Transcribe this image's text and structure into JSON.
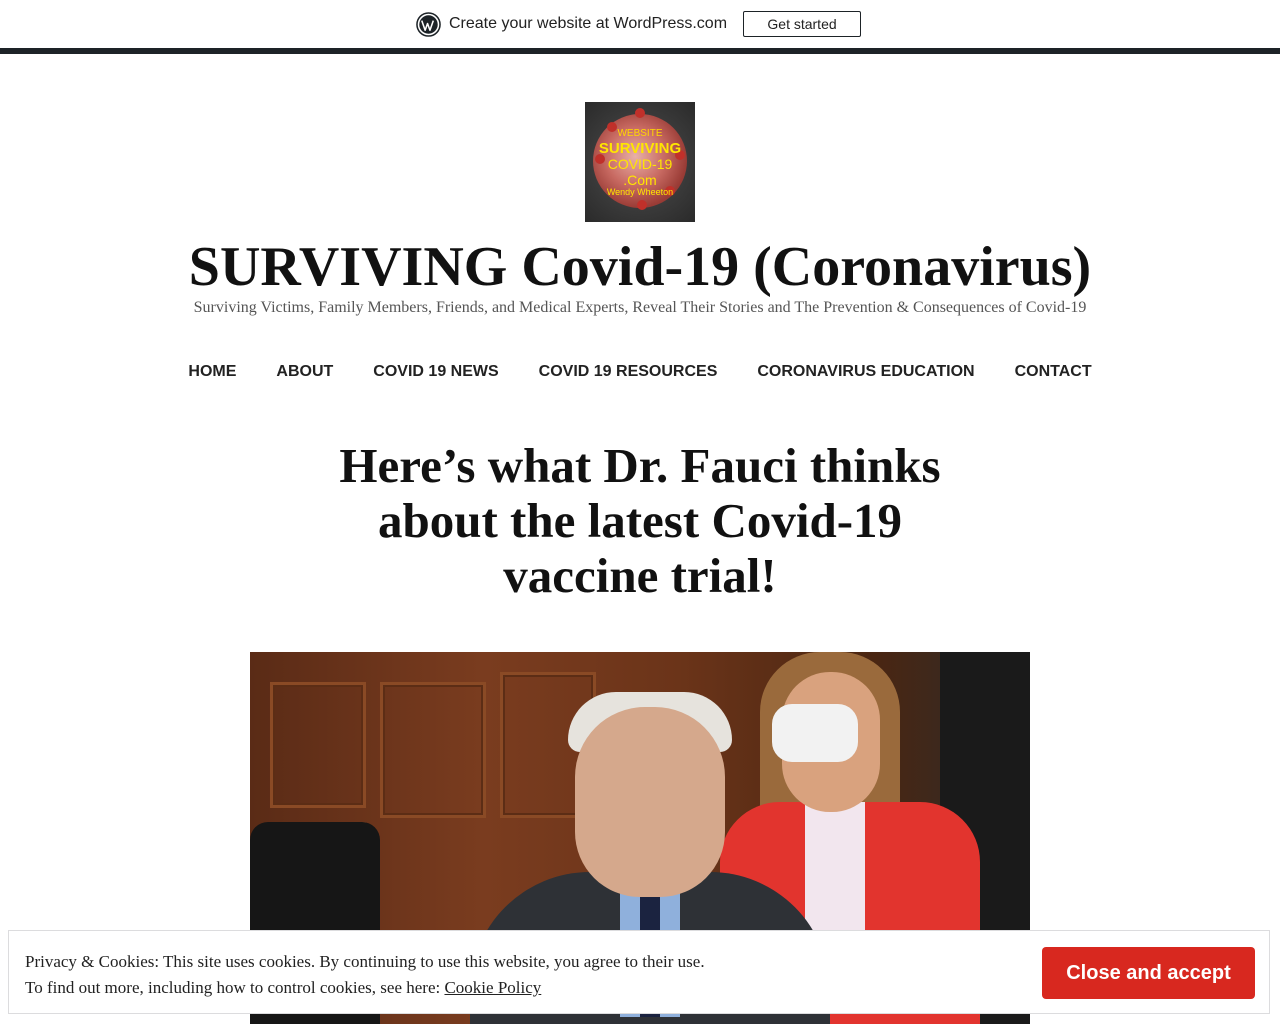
{
  "wpbar": {
    "text": "Create your website at WordPress.com",
    "button_label": "Get started"
  },
  "site": {
    "logo_text": {
      "line1": "WEBSITE",
      "line2": "SURVIVING",
      "line3": "COVID-19",
      "line4": ".Com",
      "line5": "Wendy Wheeton"
    },
    "title": "SURVIVING Covid-19 (Coronavirus)",
    "description": "Surviving Victims, Family Members, Friends, and Medical Experts, Reveal Their Stories and The Prevention & Consequences of Covid-19"
  },
  "nav": {
    "items": [
      {
        "label": "HOME"
      },
      {
        "label": "ABOUT"
      },
      {
        "label": "COVID 19 NEWS"
      },
      {
        "label": "COVID 19 RESOURCES"
      },
      {
        "label": "CORONAVIRUS EDUCATION"
      },
      {
        "label": "CONTACT"
      }
    ]
  },
  "post": {
    "title": "Here’s what Dr. Fauci thinks about the latest Covid-19 vaccine trial!"
  },
  "cookie": {
    "line1": "Privacy & Cookies: This site uses cookies. By continuing to use this website, you agree to their use.",
    "line2_prefix": "To find out more, including how to control cookies, see here: ",
    "link_label": "Cookie Policy",
    "button_label": "Close and accept"
  },
  "colors": {
    "accept_button": "#d8281f",
    "admin_bar_border": "#1d2327"
  }
}
